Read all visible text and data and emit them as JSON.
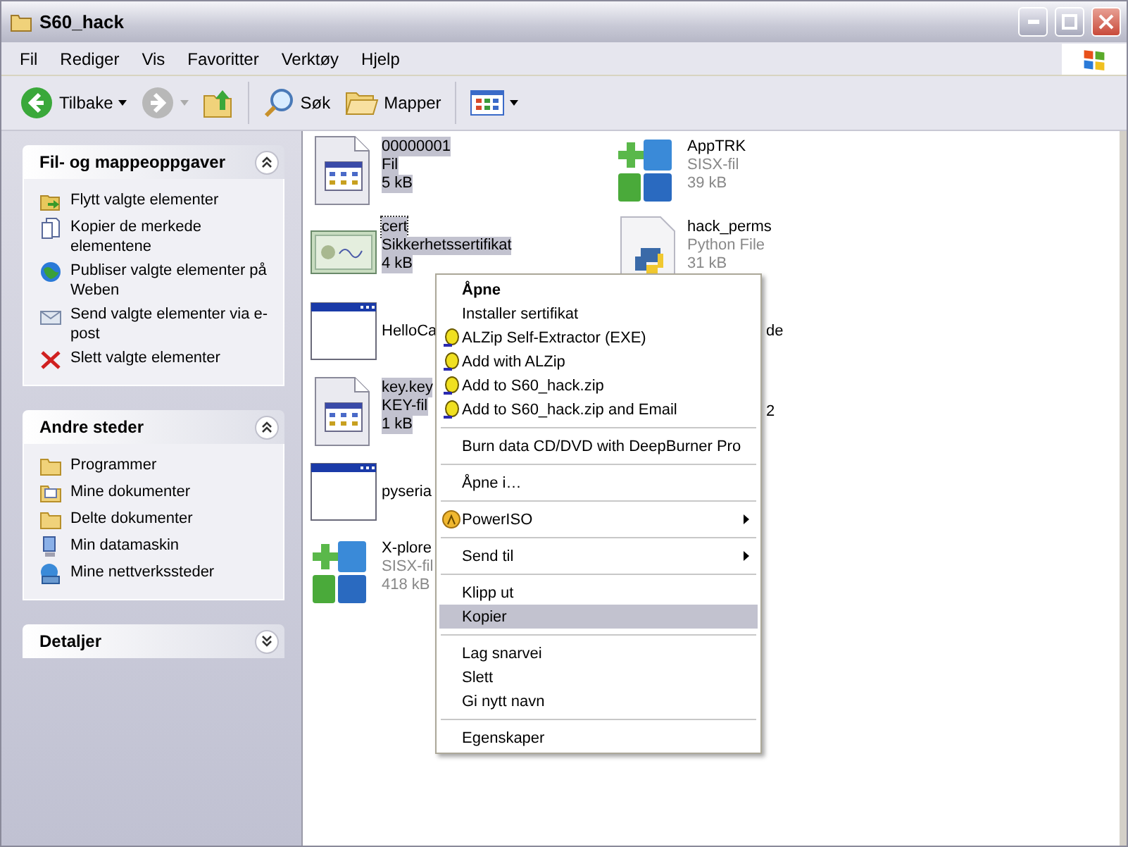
{
  "window": {
    "title": "S60_hack"
  },
  "menu_bar": [
    "Fil",
    "Rediger",
    "Vis",
    "Favoritter",
    "Verktøy",
    "Hjelp"
  ],
  "toolbar": {
    "back": {
      "label": "Tilbake",
      "disabled": false
    },
    "forward": {
      "disabled": true
    },
    "search": {
      "label": "Søk"
    },
    "folders": {
      "label": "Mapper"
    }
  },
  "sidebar": {
    "panels": [
      {
        "title": "Fil- og mappeoppgaver",
        "expanded": true,
        "items": [
          "Flytt valgte elementer",
          "Kopier de merkede elementene",
          "Publiser valgte elementer på Weben",
          "Send valgte elementer via e-post",
          "Slett valgte elementer"
        ]
      },
      {
        "title": "Andre steder",
        "expanded": true,
        "items": [
          "Programmer",
          "Mine dokumenter",
          "Delte dokumenter",
          "Min datamaskin",
          "Mine nettverkssteder"
        ]
      },
      {
        "title": "Detaljer",
        "expanded": false
      }
    ]
  },
  "file_rows": [
    [
      {
        "kind": "generic",
        "name": "00000001",
        "type": "Fil",
        "size": "5 kB",
        "selected": true,
        "focused": false
      },
      {
        "kind": "sisx",
        "name": "AppTRK",
        "type": "SISX-fil",
        "size": "39 kB",
        "selected": false,
        "focused": false
      }
    ],
    [
      {
        "kind": "certificate",
        "name": "cert",
        "type": "Sikkerhetssertifikat",
        "size": "4 kB",
        "selected": true,
        "focused": true
      },
      {
        "kind": "python",
        "name": "hack_perms",
        "type": "Python File",
        "size": "31 kB",
        "selected": false,
        "focused": false
      }
    ],
    [
      {
        "kind": "window",
        "name": "HelloCa",
        "selected": false,
        "focused": false
      },
      {
        "kind": "hidden",
        "name": "de",
        "selected": false,
        "focused": false
      }
    ],
    [
      {
        "kind": "generic",
        "name": "key.key",
        "type": "KEY-fil",
        "size": "1 kB",
        "selected": true,
        "focused": false
      },
      {
        "kind": "hidden",
        "name": "2",
        "selected": false,
        "focused": false
      }
    ],
    [
      {
        "kind": "window",
        "name": "pyseria",
        "selected": false,
        "focused": false
      }
    ],
    [
      {
        "kind": "sisx",
        "name": "X-plore",
        "type": "SISX-fil",
        "size": "418 kB",
        "selected": false,
        "focused": false
      }
    ]
  ],
  "context_menu": [
    {
      "kind": "default",
      "label": "Åpne",
      "selected": false
    },
    {
      "kind": "plain",
      "label": "Installer sertifikat",
      "selected": false
    },
    {
      "kind": "archiver",
      "label": "ALZip Self-Extractor (EXE)",
      "selected": false
    },
    {
      "kind": "archiver",
      "label": "Add with ALZip",
      "selected": false
    },
    {
      "kind": "archiver",
      "label": "Add to S60_hack.zip",
      "selected": false
    },
    {
      "kind": "archiver",
      "label": "Add to S60_hack.zip and Email",
      "selected": false
    },
    {
      "kind": "separator"
    },
    {
      "kind": "plain",
      "label": "Burn data CD/DVD with DeepBurner Pro",
      "selected": false
    },
    {
      "kind": "separator"
    },
    {
      "kind": "plain",
      "label": "Åpne i…",
      "selected": false
    },
    {
      "kind": "separator"
    },
    {
      "kind": "disc-submenu",
      "label": "PowerISO",
      "selected": false
    },
    {
      "kind": "separator"
    },
    {
      "kind": "submenu",
      "label": "Send til",
      "selected": false
    },
    {
      "kind": "separator"
    },
    {
      "kind": "plain",
      "label": "Klipp ut",
      "selected": false
    },
    {
      "kind": "plain",
      "label": "Kopier",
      "selected": true
    },
    {
      "kind": "separator"
    },
    {
      "kind": "plain",
      "label": "Lag snarvei",
      "selected": false
    },
    {
      "kind": "plain",
      "label": "Slett",
      "selected": false
    },
    {
      "kind": "plain",
      "label": "Gi nytt navn",
      "selected": false
    },
    {
      "kind": "separator"
    },
    {
      "kind": "plain",
      "label": "Egenskaper",
      "selected": false
    }
  ]
}
